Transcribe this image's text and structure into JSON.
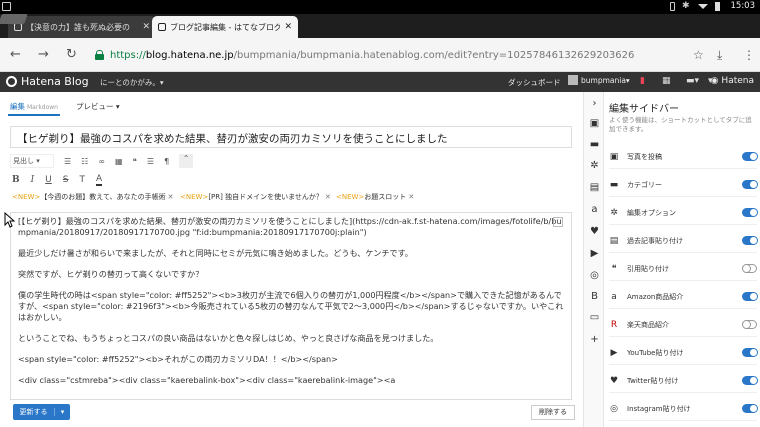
{
  "status_bar": {
    "time": "15:03"
  },
  "browser": {
    "tabs": [
      {
        "title": "【決意の力】誰も死ぬ必要の"
      },
      {
        "title": "ブログ記事編集 - はてなブログ"
      }
    ],
    "url": {
      "scheme": "https://",
      "host": "blog.hatena.ne.jp",
      "path": "/bumpmania/bumpmania.hatenablog.com/edit?entry=10257846132629203626"
    }
  },
  "hatena_header": {
    "logo_text": "Hatena Blog",
    "motto": "にーとのかがみ。▾",
    "dashboard": "ダッシュボード",
    "user": "bumpmania",
    "right_logo": "Hatena"
  },
  "editor": {
    "tab_edit": "編集",
    "tab_edit_mode": "Markdown",
    "tab_preview": "プレビュー ▾",
    "title": "【ヒゲ剃り】最強のコスパを求めた結果、替刃が激安の両刃カミソリを使うことにしました",
    "heading_select": "見出し ▾",
    "notices": [
      {
        "tag": "<NEW>",
        "text": "【今週のお題】教えて、あなたの手帳術"
      },
      {
        "tag": "<NEW>",
        "text": "[PR] 独自ドメインを使いませんか？"
      },
      {
        "tag": "<NEW>",
        "text": "お題スロット"
      }
    ],
    "body_paragraphs": [
      "[【ヒゲ剃り】最強のコスパを求めた結果、替刃が激安の両刃カミソリを使うことにしました](https://cdn-ak.f.st-hatena.com/images/fotolife/b/bumpmania/20180917/20180917170700.jpg \"f:id:bumpmania:20180917170700j:plain\")",
      "最近少しだけ暑さが和らいで来ましたが、それと同時にセミが元気に鳴き始めました。どうも、ケンチです。",
      "突然ですが、ヒゲ剃りの替刃って高くないですか？",
      "僕の学生時代の時は<span style=\"color: #ff5252\"><b>3枚刃が主流で6個入りの替刃が1,000円程度</b></span>で購入できた記憶があるんですが、<span style=\"color: #2196f3\"><b>今販売されている5枚刃の替刃なんて平気で2～3,000円</b></span>するじゃないですか。いやこれはおかしい。",
      "ということでね、もうちょっとコスパの良い商品はないかと色々探しはじめ、やっと良さげな商品を見つけました。",
      "<span style=\"color: #ff5252\"><b>それがこの両刃カミソリDA！！</b></span>",
      "<div class=\"cstmreba\"><div class=\"kaerebalink-box\"><div class=\"kaerebalink-image\"><a"
    ],
    "update_button": "更新する",
    "delete_button": "削除する"
  },
  "sidebar": {
    "title": "編集サイドバー",
    "description": "よく使う機能は、ショートカットとしてタブに追加できます。",
    "items": [
      {
        "label": "写真を投稿",
        "icon": "photo-icon",
        "on": true
      },
      {
        "label": "カテゴリー",
        "icon": "folder-icon",
        "on": true
      },
      {
        "label": "編集オプション",
        "icon": "gear-icon",
        "on": true
      },
      {
        "label": "過去記事貼り付け",
        "icon": "document-icon",
        "on": true
      },
      {
        "label": "引用貼り付け",
        "icon": "quote-icon",
        "on": false
      },
      {
        "label": "Amazon商品紹介",
        "icon": "amazon-icon",
        "on": true
      },
      {
        "label": "楽天商品紹介",
        "icon": "rakuten-icon",
        "on": false
      },
      {
        "label": "YouTube貼り付け",
        "icon": "youtube-icon",
        "on": true
      },
      {
        "label": "Twitter貼り付け",
        "icon": "twitter-icon",
        "on": true
      },
      {
        "label": "Instagram貼り付け",
        "icon": "instagram-icon",
        "on": true
      }
    ]
  },
  "colors": {
    "accent": "#2a77c9",
    "header_bg": "#333333",
    "notice_new": "#e8a317",
    "secure_green": "#0b8043"
  }
}
